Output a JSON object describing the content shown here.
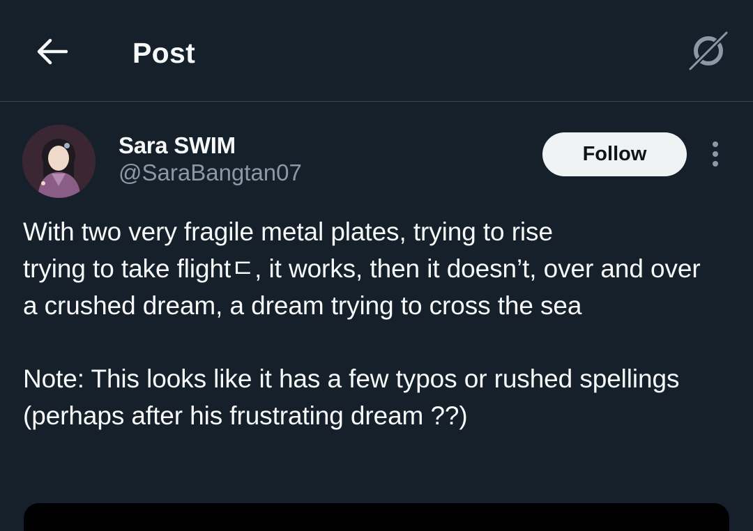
{
  "header": {
    "back_icon": "arrow-left-icon",
    "title": "Post",
    "grok_icon": "grok-icon"
  },
  "author": {
    "display_name": "Sara SWIM",
    "handle": "@SaraBangtan07",
    "avatar": "profile-avatar"
  },
  "actions": {
    "follow_label": "Follow",
    "more_icon": "more-vertical-icon"
  },
  "post": {
    "paragraph1": {
      "line1": "With two very fragile metal plates, trying to rise",
      "line2": "trying to take flightㄷ, it works, then it doesn’t, over and over",
      "line3": "a crushed dream, a dream trying to cross the sea"
    },
    "paragraph2": "Note: This looks like it has a few typos or rushed spellings (perhaps after his frustrating dream ??)"
  },
  "colors": {
    "background": "#15202b",
    "text": "#f7f9f9",
    "secondary_text": "#8b98a5",
    "follow_button_bg": "#eff3f4",
    "divider": "#38444d"
  }
}
